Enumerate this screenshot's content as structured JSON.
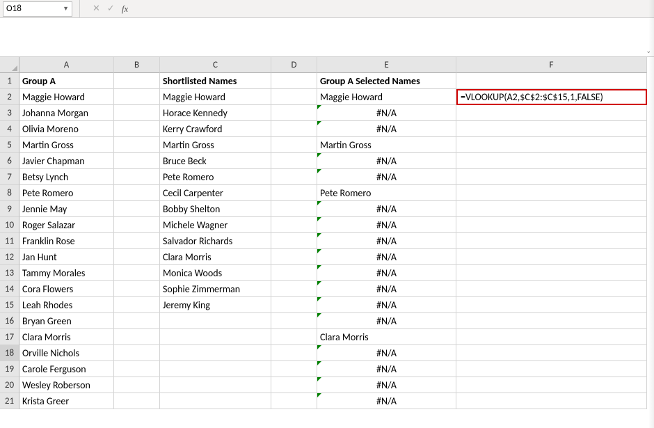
{
  "namebox": {
    "value": "O18"
  },
  "columns": [
    "A",
    "B",
    "C",
    "D",
    "E",
    "F"
  ],
  "headers": {
    "A": "Group A",
    "C": "Shortlisted Names",
    "E": "Group A Selected Names"
  },
  "groupA": [
    "Maggie Howard",
    "Johanna Morgan",
    "Olivia Moreno",
    "Martin Gross",
    "Javier Chapman",
    "Betsy Lynch",
    "Pete Romero",
    "Jennie May",
    "Roger Salazar",
    "Franklin Rose",
    "Jan Hunt",
    "Tammy Morales",
    "Cora Flowers",
    "Leah Rhodes",
    "Bryan Green",
    "Clara Morris",
    "Orville Nichols",
    "Carole Ferguson",
    "Wesley Roberson",
    "Krista Greer"
  ],
  "shortlisted": [
    "Maggie Howard",
    "Horace Kennedy",
    "Kerry Crawford",
    "Martin Gross",
    "Bruce Beck",
    "Pete Romero",
    "Cecil Carpenter",
    "Bobby Shelton",
    "Michele Wagner",
    "Salvador Richards",
    "Clara Morris",
    "Monica Woods",
    "Sophie Zimmerman",
    "Jeremy King"
  ],
  "selected": [
    "Maggie Howard",
    "#N/A",
    "#N/A",
    "Martin Gross",
    "#N/A",
    "#N/A",
    "Pete Romero",
    "#N/A",
    "#N/A",
    "#N/A",
    "#N/A",
    "#N/A",
    "#N/A",
    "#N/A",
    "#N/A",
    "Clara Morris",
    "#N/A",
    "#N/A",
    "#N/A",
    "#N/A"
  ],
  "formulaDisplay": "=VLOOKUP(A2,$C$2:$C$15,1,FALSE)",
  "naToken": "#N/A",
  "highlightRow": 18
}
